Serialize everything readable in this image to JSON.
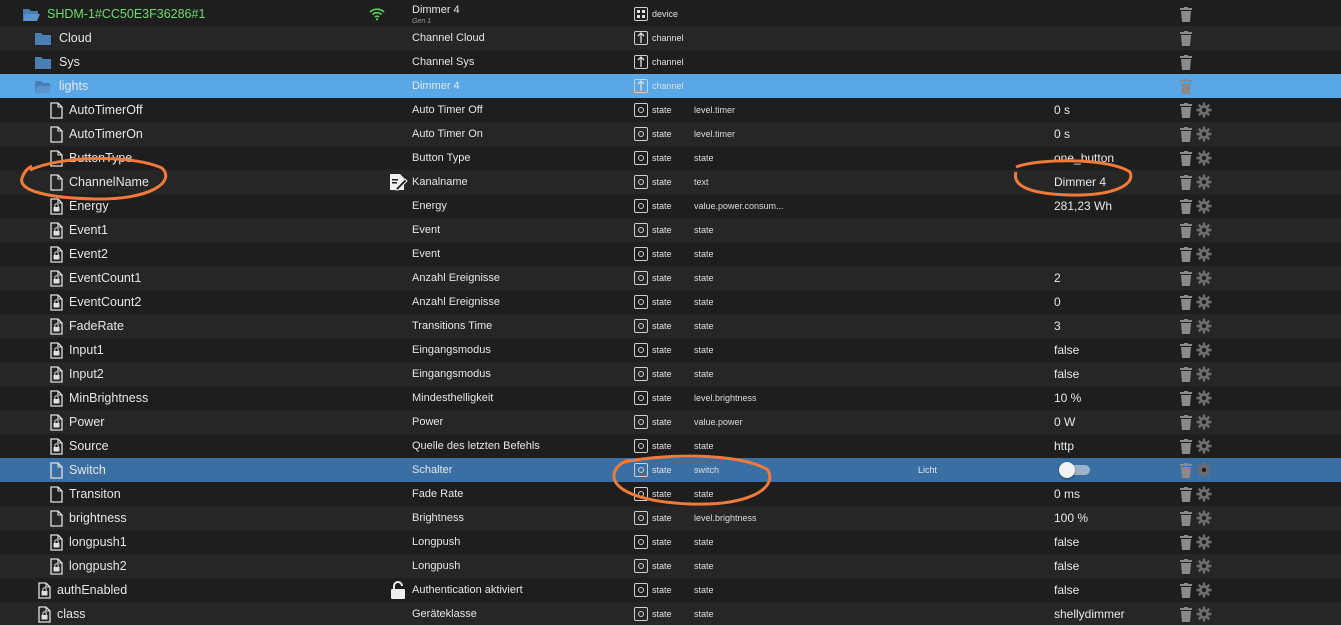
{
  "rows": [
    {
      "id": "SHDM-1#CC50E3F36286#1",
      "kind": "device",
      "name": "Dimmer 4",
      "name_sub": "Gen 1",
      "type": "device",
      "role": "",
      "room": "",
      "value": "",
      "wifi": true
    },
    {
      "id": "Cloud",
      "kind": "folder",
      "name": "Channel Cloud",
      "type": "channel",
      "role": "",
      "room": "",
      "value": ""
    },
    {
      "id": "Sys",
      "kind": "folder",
      "name": "Channel Sys",
      "type": "channel",
      "role": "",
      "room": "",
      "value": ""
    },
    {
      "id": "lights",
      "kind": "folder-open",
      "name": "Dimmer 4",
      "type": "channel",
      "role": "",
      "room": "",
      "value": "",
      "selected": "light"
    },
    {
      "id": "AutoTimerOff",
      "kind": "file",
      "name": "Auto Timer Off",
      "type": "state",
      "role": "level.timer",
      "room": "",
      "value": "0 s"
    },
    {
      "id": "AutoTimerOn",
      "kind": "file",
      "name": "Auto Timer On",
      "type": "state",
      "role": "level.timer",
      "room": "",
      "value": "0 s"
    },
    {
      "id": "ButtonType",
      "kind": "file",
      "name": "Button Type",
      "type": "state",
      "role": "state",
      "room": "",
      "value": "one_button"
    },
    {
      "id": "ChannelName",
      "kind": "file",
      "name": "Kanalname",
      "type": "state",
      "role": "text",
      "room": "",
      "value": "Dimmer 4",
      "mid": "edit-icon"
    },
    {
      "id": "Energy",
      "kind": "file-lock",
      "name": "Energy",
      "type": "state",
      "role": "value.power.consum...",
      "room": "",
      "value": "281,23 Wh"
    },
    {
      "id": "Event1",
      "kind": "file-lock",
      "name": "Event",
      "type": "state",
      "role": "state",
      "room": "",
      "value": ""
    },
    {
      "id": "Event2",
      "kind": "file-lock",
      "name": "Event",
      "type": "state",
      "role": "state",
      "room": "",
      "value": ""
    },
    {
      "id": "EventCount1",
      "kind": "file-lock",
      "name": "Anzahl Ereignisse",
      "type": "state",
      "role": "state",
      "room": "",
      "value": "2"
    },
    {
      "id": "EventCount2",
      "kind": "file-lock",
      "name": "Anzahl Ereignisse",
      "type": "state",
      "role": "state",
      "room": "",
      "value": "0"
    },
    {
      "id": "FadeRate",
      "kind": "file-lock",
      "name": "Transitions Time",
      "type": "state",
      "role": "state",
      "room": "",
      "value": "3"
    },
    {
      "id": "Input1",
      "kind": "file-lock",
      "name": "Eingangsmodus",
      "type": "state",
      "role": "state",
      "room": "",
      "value": "false"
    },
    {
      "id": "Input2",
      "kind": "file-lock",
      "name": "Eingangsmodus",
      "type": "state",
      "role": "state",
      "room": "",
      "value": "false"
    },
    {
      "id": "MinBrightness",
      "kind": "file-lock",
      "name": "Mindesthelligkeit",
      "type": "state",
      "role": "level.brightness",
      "room": "",
      "value": "10 %"
    },
    {
      "id": "Power",
      "kind": "file-lock",
      "name": "Power",
      "type": "state",
      "role": "value.power",
      "room": "",
      "value": "0 W"
    },
    {
      "id": "Source",
      "kind": "file-lock",
      "name": "Quelle des letzten Befehls",
      "type": "state",
      "role": "state",
      "room": "",
      "value": "http"
    },
    {
      "id": "Switch",
      "kind": "file",
      "name": "Schalter",
      "type": "state",
      "role": "switch",
      "room": "Licht",
      "value": "",
      "toggle": false,
      "selected": "dark"
    },
    {
      "id": "Transiton",
      "kind": "file",
      "name": "Fade Rate",
      "type": "state",
      "role": "state",
      "room": "",
      "value": "0 ms"
    },
    {
      "id": "brightness",
      "kind": "file",
      "name": "Brightness",
      "type": "state",
      "role": "level.brightness",
      "room": "",
      "value": "100 %"
    },
    {
      "id": "longpush1",
      "kind": "file-lock",
      "name": "Longpush",
      "type": "state",
      "role": "state",
      "room": "",
      "value": "false"
    },
    {
      "id": "longpush2",
      "kind": "file-lock",
      "name": "Longpush",
      "type": "state",
      "role": "state",
      "room": "",
      "value": "false"
    },
    {
      "id": "authEnabled",
      "kind": "file-lock",
      "name": "Authentication aktiviert",
      "type": "state",
      "role": "state",
      "room": "",
      "value": "false",
      "mid": "unlock-icon"
    },
    {
      "id": "class",
      "kind": "file-lock",
      "name": "Geräteklasse",
      "type": "state",
      "role": "state",
      "room": "",
      "value": "shellydimmer"
    }
  ],
  "colors": {
    "background": "#1e1e1e",
    "selected_light": "#5aa7e8",
    "selected_dark": "#3a6fa4",
    "device_text": "#6fdc6f",
    "folder": "#4a7fb5",
    "annotation": "#f07a3a"
  }
}
